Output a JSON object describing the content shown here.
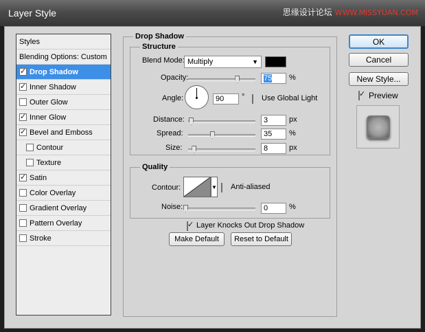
{
  "window": {
    "title": "Layer Style",
    "watermark": "思缘设计论坛",
    "watermark_url": "WWW.MISSYUAN.COM"
  },
  "styles_panel": {
    "items": [
      {
        "label": "Styles",
        "checkbox": false,
        "checked": false,
        "selected": false,
        "indent": false
      },
      {
        "label": "Blending Options: Custom",
        "checkbox": false,
        "checked": false,
        "selected": false,
        "indent": false
      },
      {
        "label": "Drop Shadow",
        "checkbox": true,
        "checked": true,
        "selected": true,
        "indent": false
      },
      {
        "label": "Inner Shadow",
        "checkbox": true,
        "checked": true,
        "selected": false,
        "indent": false
      },
      {
        "label": "Outer Glow",
        "checkbox": true,
        "checked": false,
        "selected": false,
        "indent": false
      },
      {
        "label": "Inner Glow",
        "checkbox": true,
        "checked": true,
        "selected": false,
        "indent": false
      },
      {
        "label": "Bevel and Emboss",
        "checkbox": true,
        "checked": true,
        "selected": false,
        "indent": false
      },
      {
        "label": "Contour",
        "checkbox": true,
        "checked": false,
        "selected": false,
        "indent": true
      },
      {
        "label": "Texture",
        "checkbox": true,
        "checked": false,
        "selected": false,
        "indent": true
      },
      {
        "label": "Satin",
        "checkbox": true,
        "checked": true,
        "selected": false,
        "indent": false
      },
      {
        "label": "Color Overlay",
        "checkbox": true,
        "checked": false,
        "selected": false,
        "indent": false
      },
      {
        "label": "Gradient Overlay",
        "checkbox": true,
        "checked": false,
        "selected": false,
        "indent": false
      },
      {
        "label": "Pattern Overlay",
        "checkbox": true,
        "checked": false,
        "selected": false,
        "indent": false
      },
      {
        "label": "Stroke",
        "checkbox": true,
        "checked": false,
        "selected": false,
        "indent": false
      }
    ]
  },
  "drop_shadow": {
    "section_title": "Drop Shadow",
    "structure": {
      "title": "Structure",
      "blend_mode_label": "Blend Mode:",
      "blend_mode_value": "Multiply",
      "shadow_color": "#000000",
      "opacity_label": "Opacity:",
      "opacity_value": "75",
      "opacity_unit": "%",
      "opacity_level": 0.75,
      "angle_label": "Angle:",
      "angle_value": "90",
      "angle_unit": "°",
      "use_global_light_label": "Use Global Light",
      "use_global_light_checked": false,
      "distance_label": "Distance:",
      "distance_value": "3",
      "distance_unit": "px",
      "distance_level": 0.01,
      "spread_label": "Spread:",
      "spread_value": "35",
      "spread_unit": "%",
      "spread_level": 0.35,
      "size_label": "Size:",
      "size_value": "8",
      "size_unit": "px",
      "size_level": 0.06
    },
    "quality": {
      "title": "Quality",
      "contour_label": "Contour:",
      "anti_aliased_label": "Anti-aliased",
      "anti_aliased_checked": false,
      "noise_label": "Noise:",
      "noise_value": "0",
      "noise_unit": "%",
      "noise_level": 0
    },
    "knocks_out_label": "Layer Knocks Out Drop Shadow",
    "knocks_out_checked": true,
    "make_default_label": "Make Default",
    "reset_default_label": "Reset to Default"
  },
  "buttons": {
    "ok_label": "OK",
    "cancel_label": "Cancel",
    "new_style_label": "New Style...",
    "preview_label": "Preview",
    "preview_checked": true
  },
  "colors": {
    "selection": "#3d8ee6",
    "dialog_bg": "#d5d5d5",
    "titlebar": "#4a4a4a"
  }
}
